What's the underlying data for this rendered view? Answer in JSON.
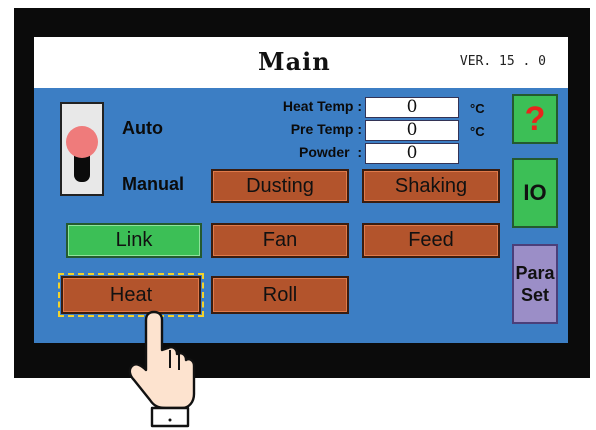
{
  "header": {
    "title": "Main",
    "version": "VER. 15 . 0"
  },
  "mode_switch": {
    "label_top": "Auto",
    "label_bottom": "Manual"
  },
  "readouts": [
    {
      "label": "Heat Temp :",
      "value": "0",
      "unit": "°C"
    },
    {
      "label": "Pre Temp :",
      "value": "0",
      "unit": "°C"
    },
    {
      "label": "Powder  :",
      "value": "0",
      "unit": ""
    }
  ],
  "buttons": {
    "dusting": "Dusting",
    "shaking": "Shaking",
    "link": "Link",
    "fan": "Fan",
    "feed": "Feed",
    "heat": "Heat",
    "roll": "Roll"
  },
  "side_buttons": {
    "help": "?",
    "io": "IO",
    "para_set_line1": "Para",
    "para_set_line2": "Set"
  },
  "colors": {
    "panel": "#3c7ec4",
    "button_orange": "#b3542c",
    "button_green": "#3cbf56",
    "side_purple": "#9b8ec7",
    "help_red": "#e8251c",
    "selection_outline": "#f2d22a"
  },
  "icons": [
    "toggle-switch-icon",
    "question-mark-icon",
    "pointing-hand-icon"
  ]
}
